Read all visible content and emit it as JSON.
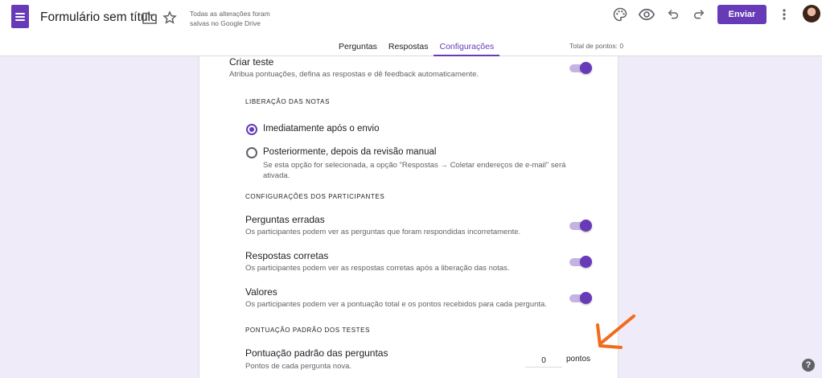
{
  "header": {
    "form_title": "Formulário sem título",
    "save_status": "Todas as alterações foram salvas no Google Drive",
    "send_label": "Enviar",
    "total_points": "Total de pontos: 0"
  },
  "tabs": [
    {
      "label": "Perguntas",
      "active": false
    },
    {
      "label": "Respostas",
      "active": false
    },
    {
      "label": "Configurações",
      "active": true
    }
  ],
  "quiz": {
    "title": "Criar teste",
    "description": "Atribua pontuações, defina as respostas e dê feedback automaticamente.",
    "enabled": true
  },
  "release": {
    "heading": "LIBERAÇÃO DAS NOTAS",
    "option_immediate": "Imediatamente após o envio",
    "option_later": "Posteriormente, depois da revisão manual",
    "option_later_note_line1": "Se esta opção for selecionada, a opção \"Respostas → Coletar endereços de e-mail\" será",
    "option_later_note_line2": "ativada.",
    "selected": "immediate"
  },
  "participants": {
    "heading": "CONFIGURAÇÕES DOS PARTICIPANTES",
    "items": [
      {
        "title": "Perguntas erradas",
        "description": "Os participantes podem ver as perguntas que foram respondidas incorretamente.",
        "enabled": true
      },
      {
        "title": "Respostas corretas",
        "description": "Os participantes podem ver as respostas corretas após a liberação das notas.",
        "enabled": true
      },
      {
        "title": "Valores",
        "description": "Os participantes podem ver a pontuação total e os pontos recebidos para cada pergunta.",
        "enabled": true
      }
    ]
  },
  "default_points": {
    "heading": "PONTUAÇÃO PADRÃO DOS TESTES",
    "title": "Pontuação padrão das perguntas",
    "description": "Pontos de cada pergunta nova.",
    "value": "0",
    "unit": "pontos"
  },
  "colors": {
    "accent": "#673ab7",
    "background": "#f0ebf8",
    "annotation_arrow": "#f26b1d"
  },
  "icons": [
    "forms-app-icon",
    "folder-icon",
    "star-icon",
    "palette-icon",
    "eye-icon",
    "undo-icon",
    "redo-icon",
    "more-vert-icon",
    "avatar",
    "help-icon",
    "annotation-arrow-icon"
  ]
}
